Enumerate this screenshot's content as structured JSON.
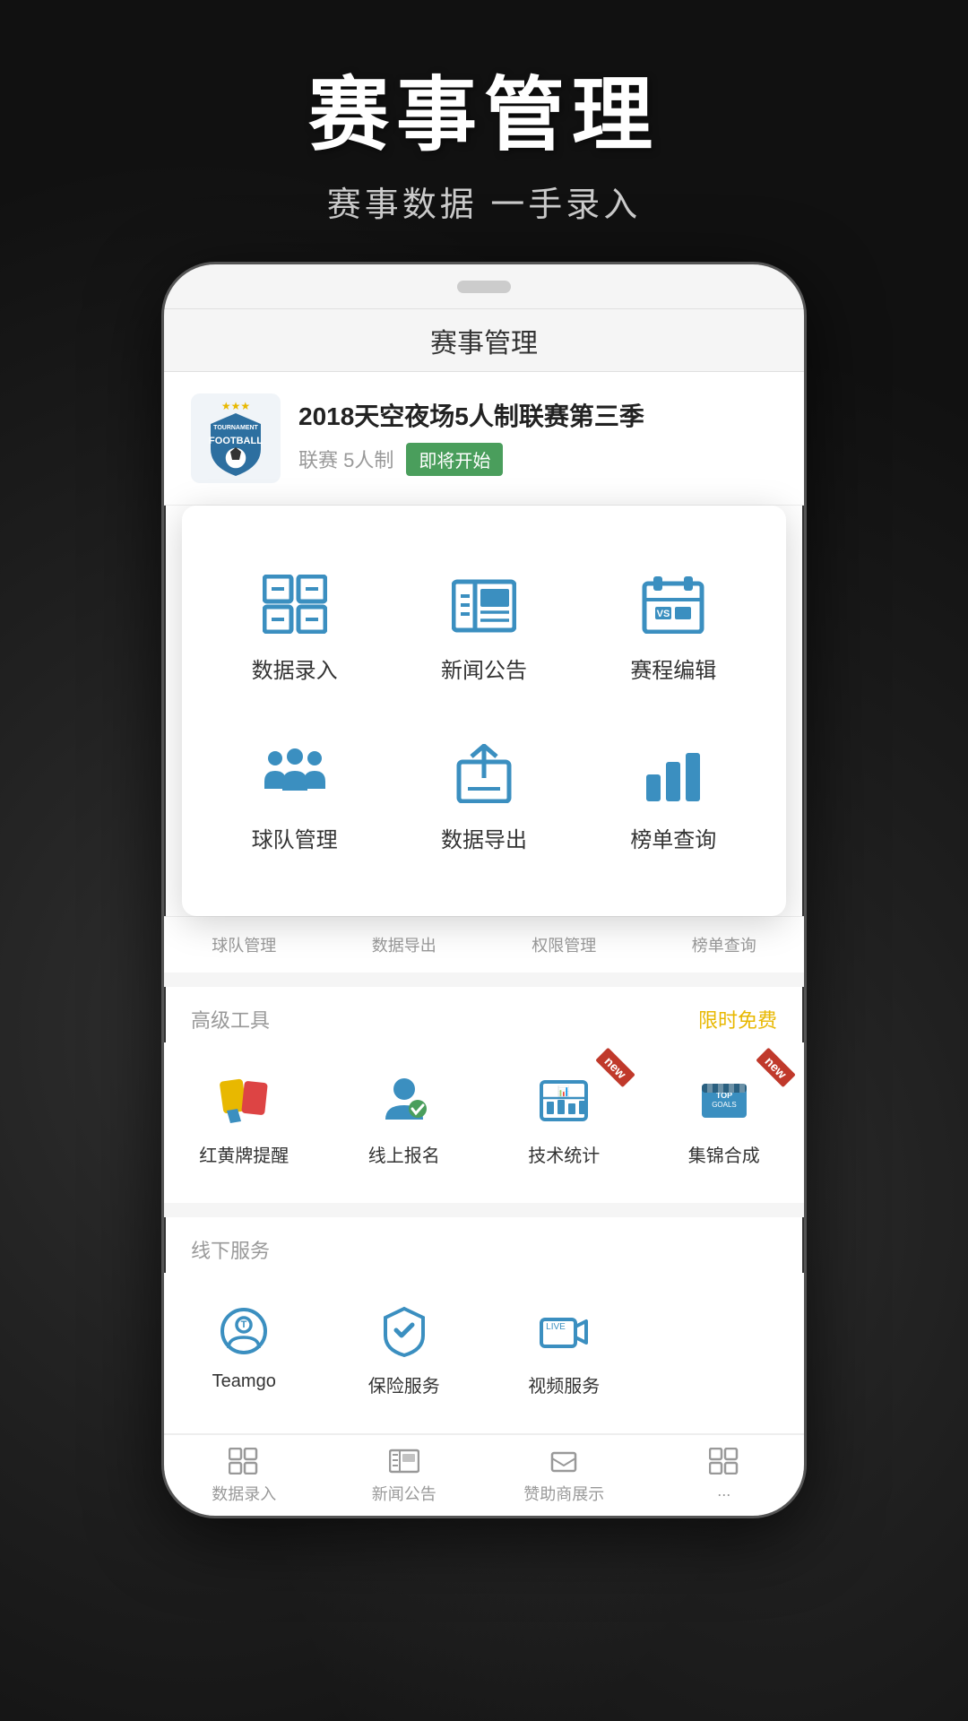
{
  "hero": {
    "title": "赛事管理",
    "subtitle": "赛事数据 一手录入"
  },
  "phone": {
    "title": "赛事管理"
  },
  "tournament": {
    "name": "2018天空夜场5人制联赛第三季",
    "meta": "联赛 5人制",
    "status": "即将开始"
  },
  "main_menu": {
    "items": [
      {
        "label": "数据录入",
        "icon": "data-entry"
      },
      {
        "label": "新闻公告",
        "icon": "news"
      },
      {
        "label": "赛程编辑",
        "icon": "schedule"
      },
      {
        "label": "球队管理",
        "icon": "team"
      },
      {
        "label": "数据导出",
        "icon": "export"
      },
      {
        "label": "榜单查询",
        "icon": "ranking"
      }
    ]
  },
  "bottom_nav": {
    "items": [
      "球队管理",
      "数据导出",
      "权限管理",
      "榜单查询"
    ]
  },
  "advanced_tools": {
    "section_label": "高级工具",
    "badge": "限时免费",
    "items": [
      {
        "label": "红黄牌提醒",
        "icon": "card",
        "new": false
      },
      {
        "label": "线上报名",
        "icon": "register",
        "new": false
      },
      {
        "label": "技术统计",
        "icon": "stats",
        "new": true
      },
      {
        "label": "集锦合成",
        "icon": "highlight",
        "new": true
      }
    ]
  },
  "offline_services": {
    "section_label": "线下服务",
    "items": [
      {
        "label": "Teamgo",
        "icon": "teamgo"
      },
      {
        "label": "保险服务",
        "icon": "insurance"
      },
      {
        "label": "视频服务",
        "icon": "video"
      }
    ]
  },
  "bottom_tabs": {
    "items": [
      "数据录入",
      "新闻公告",
      "赞助商展示",
      "..."
    ]
  }
}
